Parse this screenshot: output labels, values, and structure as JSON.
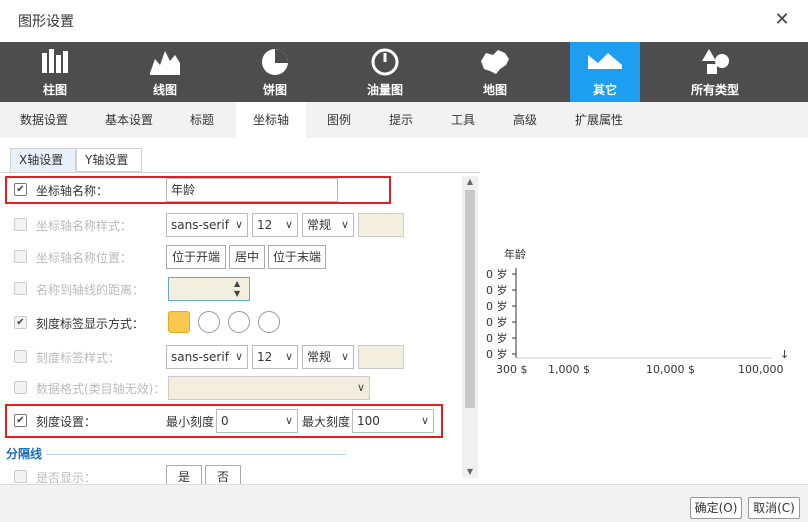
{
  "dialog": {
    "title": "图形设置"
  },
  "chart_types": [
    {
      "label": "柱图",
      "icon": "bar-chart-icon"
    },
    {
      "label": "线图",
      "icon": "line-chart-icon"
    },
    {
      "label": "饼图",
      "icon": "pie-chart-icon"
    },
    {
      "label": "油量图",
      "icon": "gauge-icon"
    },
    {
      "label": "地图",
      "icon": "map-china-icon"
    },
    {
      "label": "其它",
      "icon": "other-chart-icon",
      "active": true
    },
    {
      "label": "所有类型",
      "icon": "all-types-icon"
    }
  ],
  "tabs": [
    "数据设置",
    "基本设置",
    "标题",
    "坐标轴",
    "图例",
    "提示",
    "工具",
    "高级",
    "扩展属性"
  ],
  "active_tab": "坐标轴",
  "sub_tabs": [
    "X轴设置",
    "Y轴设置"
  ],
  "form": {
    "axis_name": {
      "label": "坐标轴名称：",
      "checked": true,
      "value": "年龄"
    },
    "axis_name_style": {
      "label": "坐标轴名称样式：",
      "font": "sans-serif",
      "size": "12",
      "weight": "常规"
    },
    "axis_name_pos": {
      "label": "坐标轴名称位置：",
      "opt1": "位于开端",
      "opt2": "居中",
      "opt3": "位于末端"
    },
    "name_distance": {
      "label": "名称到轴线的距离："
    },
    "tick_label_mode": {
      "label": "刻度标签显示方式：",
      "checked": true
    },
    "tick_label_style": {
      "label": "刻度标签样式：",
      "font": "sans-serif",
      "size": "12",
      "weight": "常规"
    },
    "data_format": {
      "label": "数据格式(类目轴无效)："
    },
    "scale": {
      "label": "刻度设置：",
      "checked": true,
      "min_label": "最小刻度",
      "min_value": "0",
      "max_label": "最大刻度",
      "max_value": "100"
    },
    "splitline": {
      "title": "分隔线",
      "show_label": "是否显示：",
      "yes": "是",
      "no": "否"
    }
  },
  "preview": {
    "chart_data": {
      "type": "scatter",
      "title": "",
      "ylabel": "年龄",
      "x_ticks": [
        "300 $",
        "1,000 $",
        "10,000 $",
        "100,000"
      ],
      "y_ticks": [
        "0 岁",
        "0 岁",
        "0 岁",
        "0 岁",
        "0 岁",
        "0 岁"
      ],
      "series": []
    }
  },
  "footer": {
    "ok": "确定(O)",
    "cancel": "取消(C)"
  },
  "colors": {
    "accent": "#1e9ef1",
    "dark_bar": "#4d4d4d",
    "highlight": "#e02020"
  }
}
